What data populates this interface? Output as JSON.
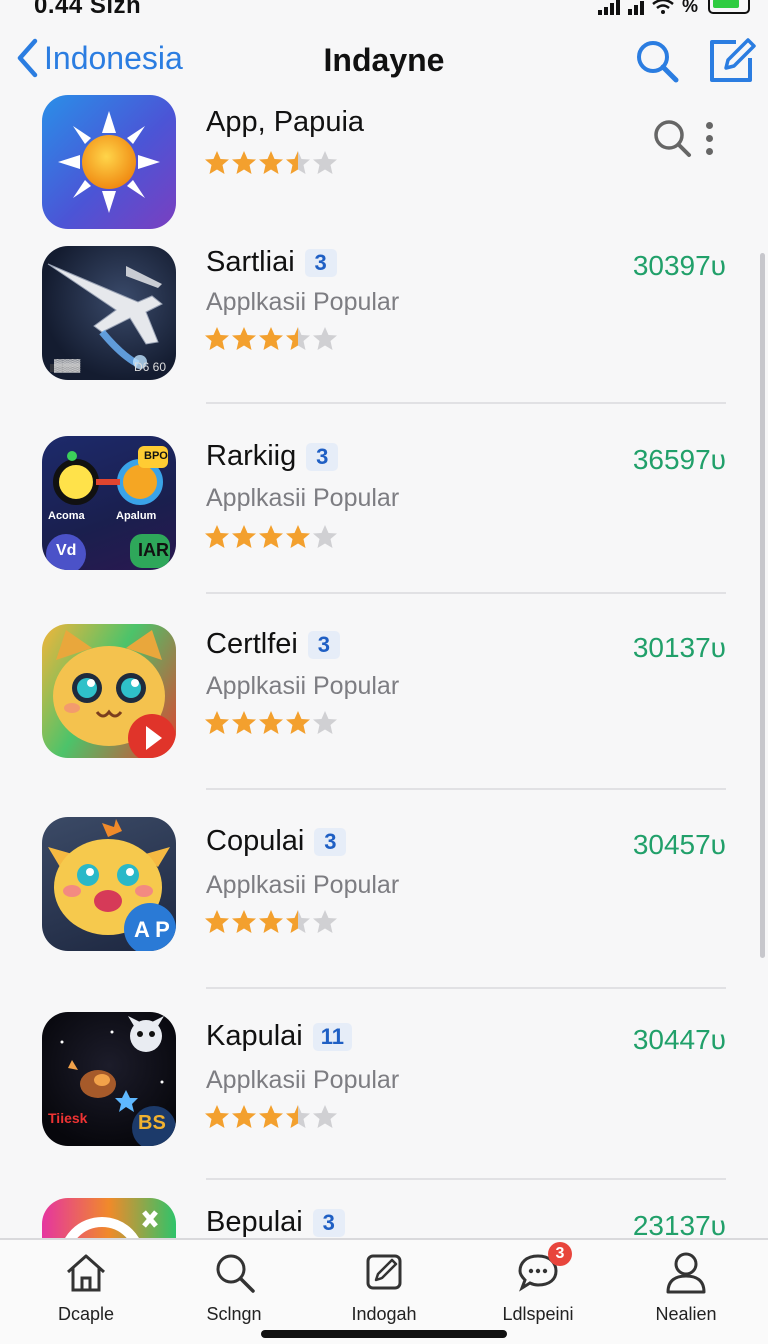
{
  "status_bar": {
    "time": "0.44 Sizn",
    "battery_label": "%"
  },
  "nav": {
    "back_label": "Indonesia",
    "title": "Indayne"
  },
  "featured": {
    "name": "App, Papuia",
    "rating": 3.5,
    "icon": "sun-icon"
  },
  "apps": [
    {
      "name": "Sartliai",
      "badge": "3",
      "subtitle": "Applkasii Popular",
      "count": "30397υ",
      "rating": 3.5,
      "icon": "airplane-game-icon",
      "icon_text": [
        "▓▓▓",
        "D6 60"
      ]
    },
    {
      "name": "Rarkiig",
      "badge": "3",
      "subtitle": "Applkasii Popular",
      "count": "36597υ",
      "rating": 4,
      "icon": "glasses-app-icon",
      "icon_text": [
        "Acoma",
        "Apalum",
        "Vd",
        "IAR",
        "BPO"
      ]
    },
    {
      "name": "Certlfei",
      "badge": "3",
      "subtitle": "Applkasii Popular",
      "count": "30137υ",
      "rating": 4,
      "icon": "cat-mascot-icon",
      "icon_text": []
    },
    {
      "name": "Copulai",
      "badge": "3",
      "subtitle": "Applkasii Popular",
      "count": "30457υ",
      "rating": 3.5,
      "icon": "cute-creature-icon",
      "icon_text": [
        "A P"
      ]
    },
    {
      "name": "Kapulai",
      "badge": "11",
      "subtitle": "Applkasii Popular",
      "count": "30447υ",
      "rating": 3.5,
      "icon": "space-game-icon",
      "icon_text": [
        "Tiiesk",
        "BS"
      ]
    },
    {
      "name": "Bepulai",
      "badge": "3",
      "subtitle": "",
      "count": "23137υ",
      "rating": 0,
      "icon": "colorful-app-icon",
      "icon_text": []
    }
  ],
  "tabs": [
    {
      "label": "Dcaple",
      "icon": "home-icon"
    },
    {
      "label": "Sclngn",
      "icon": "search-icon"
    },
    {
      "label": "Indogah",
      "icon": "compose-icon"
    },
    {
      "label": "Ldlspeini",
      "icon": "chat-bubble-icon",
      "badge": "3"
    },
    {
      "label": "Nealien",
      "icon": "profile-icon"
    }
  ],
  "colors": {
    "accent": "#2b7de1",
    "count": "#21a06a",
    "star": "#f3a02e",
    "star_empty": "#d0d0d3",
    "badge_bg": "#e6edf8",
    "notify": "#e8453c"
  }
}
